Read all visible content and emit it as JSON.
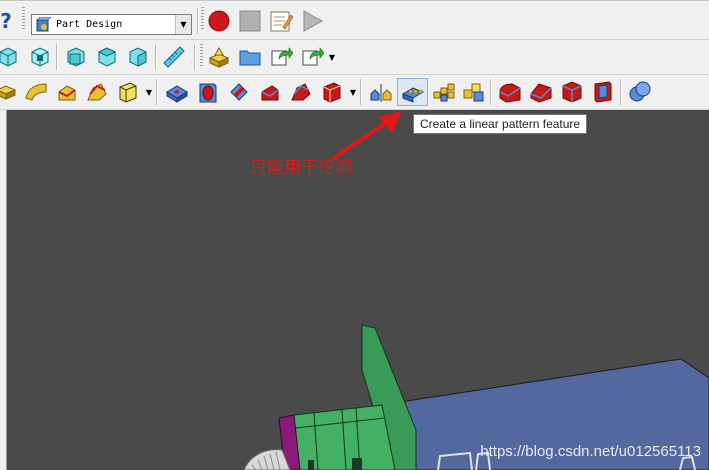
{
  "toolbar": {
    "workbench": {
      "label": "Part Design",
      "icon": "freecad-part-design-icon"
    },
    "macro": {
      "record_icon": "record-macro-icon",
      "stop_icon": "stop-macro-icon",
      "edit_icon": "edit-macro-icon",
      "play_icon": "run-macro-icon"
    }
  },
  "tooltip": {
    "text": "Create a linear pattern feature"
  },
  "annotation": {
    "text": "只能用于挖洞",
    "color": "#d81e1e"
  },
  "viewport": {
    "background": "#4a4a4a"
  },
  "watermark": {
    "text": "https://blog.csdn.net/u012565113"
  }
}
